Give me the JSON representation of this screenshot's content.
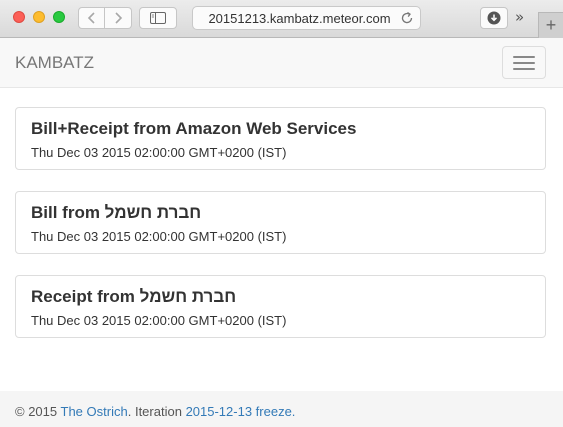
{
  "browser": {
    "url": "20151213.kambatz.meteor.com",
    "more_label": "»",
    "new_tab_label": "+"
  },
  "navbar": {
    "brand": "KAMBATZ"
  },
  "documents": [
    {
      "title": "Bill+Receipt from Amazon Web Services",
      "date": "Thu Dec 03 2015 02:00:00 GMT+0200 (IST)"
    },
    {
      "title": "Bill from חברת חשמל",
      "date": "Thu Dec 03 2015 02:00:00 GMT+0200 (IST)"
    },
    {
      "title": "Receipt from חברת חשמל",
      "date": "Thu Dec 03 2015 02:00:00 GMT+0200 (IST)"
    }
  ],
  "footer": {
    "copyright": "© 2015",
    "author_link": "The Ostrich",
    "period": ".",
    "iteration_label": "Iteration",
    "iteration_link": "2015-12-13 freeze."
  },
  "colors": {
    "link": "#337ab7",
    "navbar_bg": "#f8f8f8",
    "footer_bg": "#f5f5f5"
  }
}
